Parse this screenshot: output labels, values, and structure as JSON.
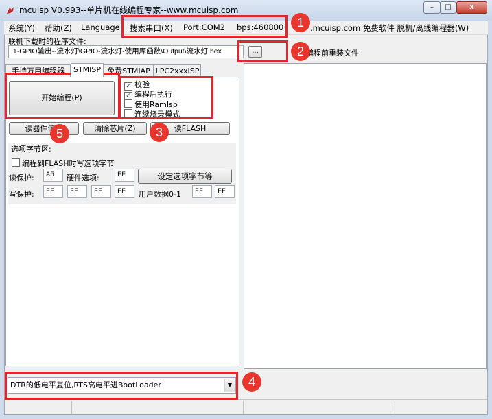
{
  "window": {
    "title": "mcuisp V0.993--单片机在线编程专家--www.mcuisp.com",
    "minimize": "–",
    "maximize": "□",
    "close": "x"
  },
  "menu": {
    "system": "系统(Y)",
    "help": "帮助(Z)",
    "language": "Language",
    "search_port": "搜索串口(X)",
    "port": "Port:COM2",
    "bps": "bps:460800",
    "website": ".mcuisp.com 免费软件 脱机/离线编程器(W)"
  },
  "file": {
    "label": "联机下载时的程序文件:",
    "path": ",1-GPIO输出--流水灯\\GPIO-流水灯-使用库函数\\Output\\流水灯.hex",
    "browse": "...",
    "reinstall_label": "编程前重装文件"
  },
  "tabs": [
    "手持万用编程器",
    "STMISP",
    "免费STMIAP",
    "LPC2xxxISP"
  ],
  "actions": {
    "start": "开始编程(P)",
    "read_info": "读器件信息",
    "erase": "清除芯片(Z)",
    "read_flash": "读FLASH"
  },
  "options": {
    "verify": {
      "label": "校验",
      "checked": true
    },
    "run_after": {
      "label": "编程后执行",
      "checked": true
    },
    "ramisp": {
      "label": "使用RamIsp",
      "checked": false
    },
    "continuous": {
      "label": "连续烧录模式",
      "checked": false
    }
  },
  "option_bytes": {
    "title": "选项字节区:",
    "write_to_flash": "编程到FLASH时写选项字节",
    "read_protect_label": "读保护:",
    "read_protect": "A5",
    "hw_option_label": "硬件选项:",
    "hw_option": "FF",
    "set_button": "设定选项字节等",
    "write_protect_label": "写保护:",
    "write_protect": [
      "FF",
      "FF",
      "FF",
      "FF"
    ],
    "user_data_label": "用户数据0-1",
    "user_data": [
      "FF",
      "FF"
    ]
  },
  "reset_mode": {
    "selected": "DTR的低电平复位,RTS高电平进BootLoader"
  },
  "annotations": [
    "1",
    "2",
    "3",
    "4",
    "5"
  ],
  "colors": {
    "annotation_red": "#e0262f",
    "title_bar": "#cfdaea"
  }
}
